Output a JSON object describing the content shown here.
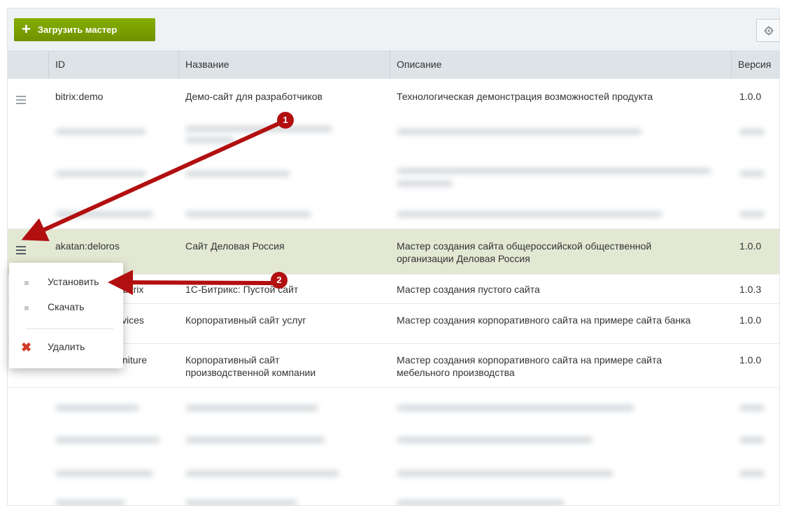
{
  "toolbar": {
    "upload_label": "Загрузить мастер",
    "upload_icon": "plus-icon",
    "settings_icon": "gear-icon"
  },
  "table": {
    "columns": [
      "ID",
      "Название",
      "Описание",
      "Версия"
    ],
    "rows": [
      {
        "id": "bitrix:demo",
        "name": "Демо-сайт для разработчиков",
        "desc": "Технологическая демонстрация возможностей продукта",
        "version": "1.0.0"
      },
      {
        "id": "akatan:deloros",
        "name": "Сайт Деловая Россия",
        "desc": "Мастер создания сайта общероссийской общественной организации Деловая Россия",
        "version": "1.0.0"
      },
      {
        "id": "1С-Битрикс: Пустой сайт",
        "id_visible": "y_bitrix",
        "name": "1С-Битрикс: Пустой сайт",
        "desc": "Мастер создания пустого сайта",
        "version": "1.0.3"
      },
      {
        "id_visible": "vices",
        "name": "Корпоративный сайт услуг",
        "desc": "Мастер создания корпоративного сайта на примере сайта банка",
        "version": "1.0.0"
      },
      {
        "id_visible": "niture",
        "name": "Корпоративный сайт производственной компании",
        "desc": "Мастер создания корпоративного сайта на примере сайта мебельного производства",
        "version": "1.0.0"
      }
    ]
  },
  "context_menu": {
    "items": [
      "Установить",
      "Скачать",
      "Удалить"
    ],
    "delete_icon": "close-icon"
  },
  "annotations": {
    "badge1": "1",
    "badge2": "2",
    "arrow_color": "#b20f10"
  },
  "colors": {
    "accent_green": "#7ba000",
    "selected_row": "#e3e8d3",
    "header_bg": "#dde3e7"
  }
}
